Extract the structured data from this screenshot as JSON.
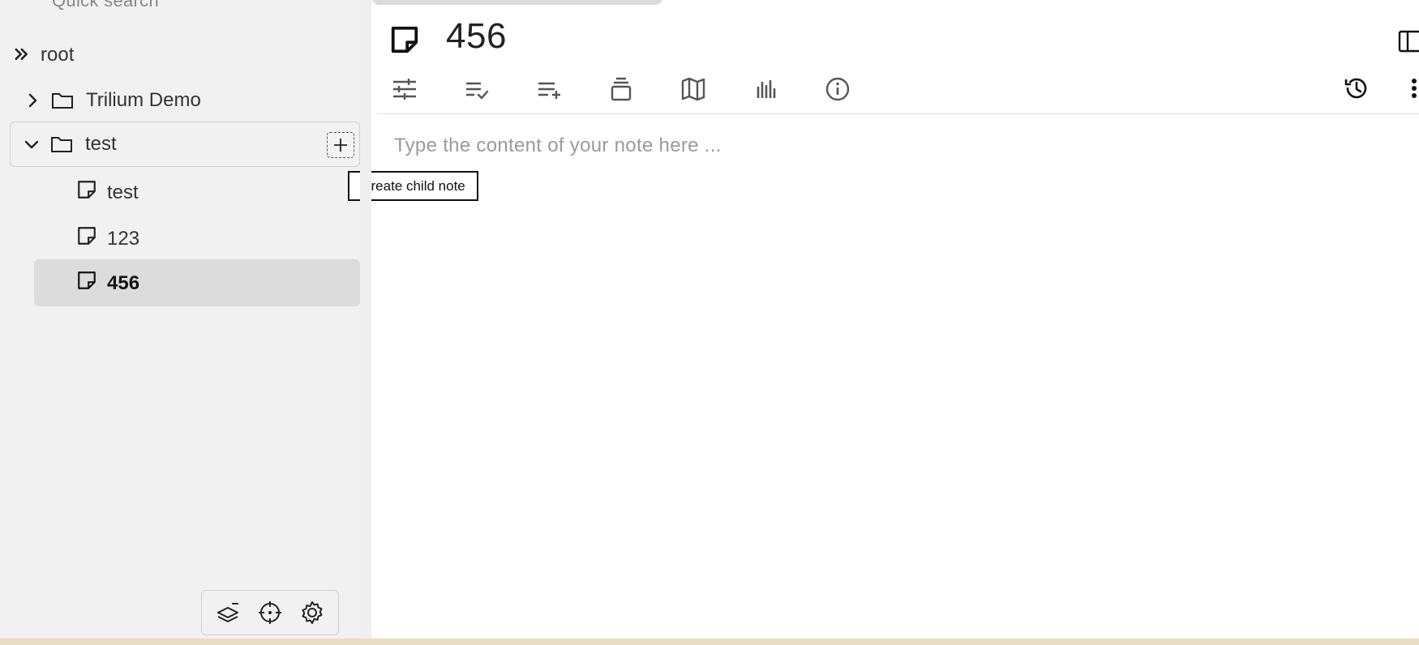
{
  "window": {
    "title": "456"
  },
  "sidebar": {
    "quick_search_label": "Quick search",
    "root": {
      "label": "root",
      "icon": "collapse-all-icon"
    },
    "tree": [
      {
        "label": "Trilium Demo",
        "icon": "folder-icon",
        "expander": "chevron-right-icon",
        "expanded": false
      },
      {
        "label": "test",
        "icon": "folder-icon",
        "expander": "chevron-down-icon",
        "expanded": true,
        "hovered": true,
        "children": [
          {
            "label": "test",
            "icon": "note-icon"
          },
          {
            "label": "123",
            "icon": "note-icon"
          },
          {
            "label": "456",
            "icon": "note-icon",
            "selected": true
          }
        ]
      }
    ],
    "create_child_tooltip": "Create child note",
    "bottom_toolbar": [
      "layers-icon",
      "locate-icon",
      "settings-icon"
    ]
  },
  "note": {
    "title": "456",
    "ribbon_tabs": [
      "basic-properties-icon",
      "owned-attributes-icon",
      "inherited-attributes-icon",
      "note-paths-icon",
      "note-map-icon",
      "similar-notes-icon",
      "note-info-icon"
    ],
    "ribbon_right": [
      "note-revisions-icon",
      "more-options-icon"
    ],
    "placeholder": "Type the content of your note here ..."
  },
  "colors": {
    "sidebar_bg": "#f1f1f1",
    "selected_bg": "#dcdcdc",
    "placeholder": "#9a9a9a"
  }
}
